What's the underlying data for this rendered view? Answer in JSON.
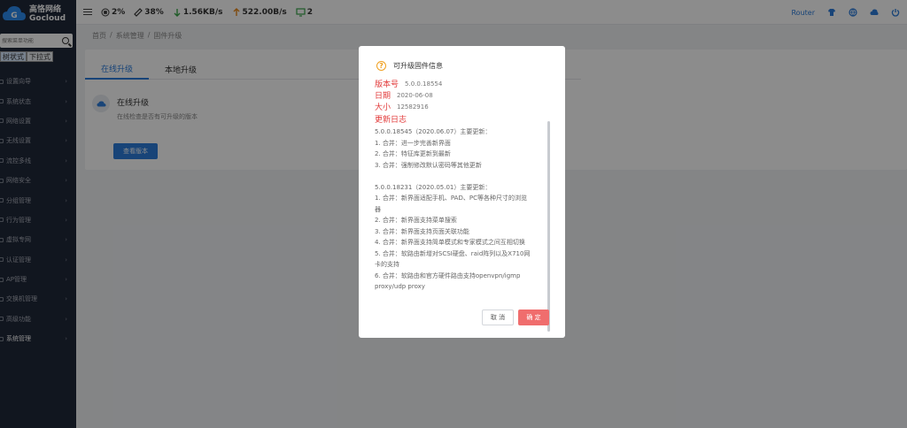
{
  "brand": {
    "name_cn": "高恪网络",
    "name_en": "Gocloud"
  },
  "sidebar": {
    "search_placeholder": "搜索菜单功能",
    "modes": [
      {
        "label": "树状式"
      },
      {
        "label": "下拉式"
      }
    ],
    "items": [
      {
        "label": "设置向导"
      },
      {
        "label": "系统状态"
      },
      {
        "label": "网络设置"
      },
      {
        "label": "无线设置"
      },
      {
        "label": "流控多线"
      },
      {
        "label": "网络安全"
      },
      {
        "label": "分组管理"
      },
      {
        "label": "行为管理"
      },
      {
        "label": "虚拟专网"
      },
      {
        "label": "认证管理"
      },
      {
        "label": "AP管理"
      },
      {
        "label": "交换机管理"
      },
      {
        "label": "高级功能"
      },
      {
        "label": "系统管理"
      }
    ]
  },
  "topbar": {
    "cpu": "2%",
    "memory": "38%",
    "download": "1.56KB/s",
    "upload": "522.00B/s",
    "devices": "2",
    "router_label": "Router"
  },
  "breadcrumb": [
    "首页",
    "/",
    "系统管理",
    "/",
    "固件升级"
  ],
  "main": {
    "tabs": [
      {
        "label": "在线升级"
      },
      {
        "label": "本地升级"
      }
    ],
    "upgrade_title": "在线升级",
    "upgrade_desc": "在线检查是否有可升级的版本",
    "check_button": "查看版本"
  },
  "modal": {
    "title": "可升级固件信息",
    "version_label": "版本号",
    "version_value": "5.0.0.18554",
    "date_label": "日期",
    "date_value": "2020-06-08",
    "size_label": "大小",
    "size_value": "12582916",
    "log_title": "更新日志",
    "log_lines": [
      "5.0.0.18545（2020.06.07）主要更新：",
      "1. 合并：进一步完善新界面",
      "2. 合并：特征库更新到最新",
      "3. 合并：强制修改默认密码等其他更新",
      "",
      "5.0.0.18231（2020.05.01）主要更新：",
      "1. 合并：新界面适配手机、PAD、PC等各种尺寸的浏览",
      "器",
      "2. 合并：新界面支持菜单搜索",
      "3. 合并：新界面支持页面关联功能",
      "4. 合并：新界面支持简单模式和专家模式之间互相切换",
      "5. 合并：软路由新增对SCSI硬盘、raid阵列以及X710网",
      "卡的支持",
      "6. 合并：软路由和官方硬件路由支持openvpn/igmp",
      "proxy/udp proxy"
    ],
    "cancel_label": "取 消",
    "ok_label": "确 定"
  },
  "colors": {
    "accent": "#2d7ddb",
    "danger": "#e23a3a",
    "ok_button": "#f06d6d",
    "sidebar_bg": "#20283a"
  }
}
